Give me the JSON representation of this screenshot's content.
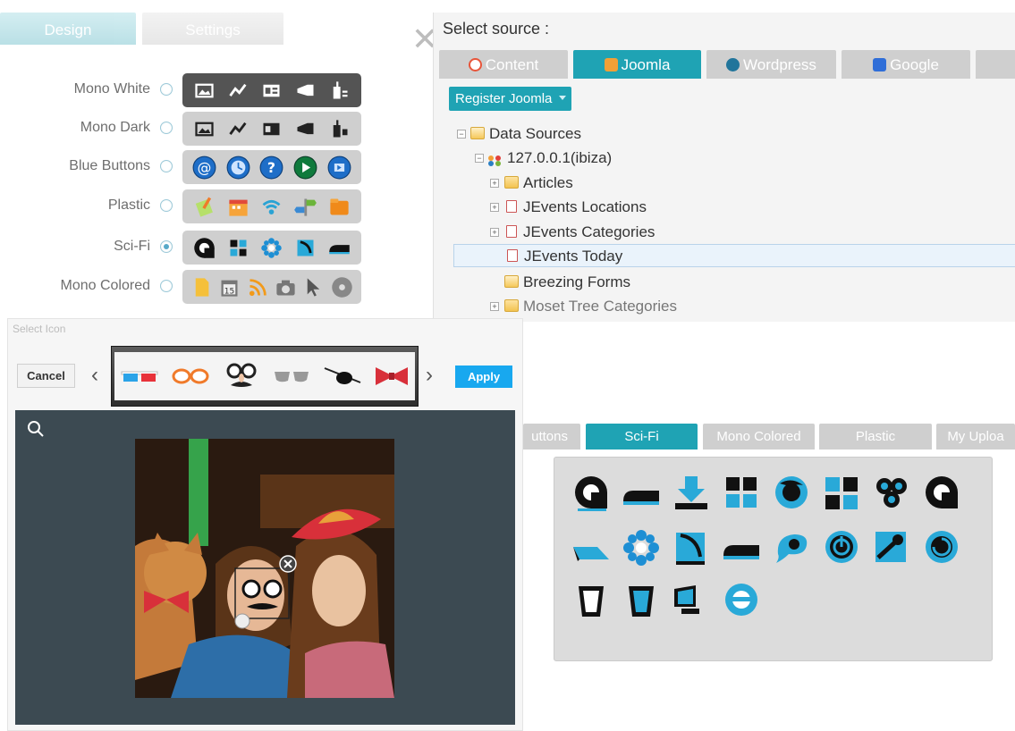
{
  "top_tabs": [
    "Design",
    "Settings"
  ],
  "themes": [
    {
      "label": "Mono White",
      "selected": false,
      "style": "dark",
      "icons": [
        "image-icon",
        "chart-icon",
        "id-card-icon",
        "megaphone-icon",
        "drink-icon"
      ]
    },
    {
      "label": "Mono Dark",
      "selected": false,
      "style": "light",
      "icons": [
        "image-icon",
        "chart-icon",
        "id-card-icon",
        "megaphone-icon",
        "drink-icon"
      ]
    },
    {
      "label": "Blue Buttons",
      "selected": false,
      "style": "light",
      "icons": [
        "at-sign-icon",
        "clock-icon",
        "help-icon",
        "play-icon",
        "video-icon"
      ]
    },
    {
      "label": "Plastic",
      "selected": false,
      "style": "light",
      "icons": [
        "notepad-icon",
        "calendar-icon",
        "wifi-icon",
        "signpost-icon",
        "folder-icon"
      ]
    },
    {
      "label": "Sci-Fi",
      "selected": true,
      "style": "light",
      "icons": [
        "at-sign-icon",
        "windows-icon",
        "flower-icon",
        "feather-icon",
        "button-icon"
      ]
    },
    {
      "label": "Mono Colored",
      "selected": false,
      "style": "light",
      "icons": [
        "document-icon",
        "calendar-icon",
        "rss-icon",
        "camera-icon",
        "cursor-icon",
        "disc-icon"
      ]
    }
  ],
  "source": {
    "title": "Select source :",
    "tabs": [
      {
        "label": "Content",
        "icon": "content-icon",
        "color": "#e8553a",
        "active": false
      },
      {
        "label": "Joomla",
        "icon": "joomla-icon",
        "color": "#f2a036",
        "active": true
      },
      {
        "label": "Wordpress",
        "icon": "wordpress-icon",
        "color": "#21759b",
        "active": false
      },
      {
        "label": "Google",
        "icon": "google-icon",
        "color": "#2f6ed8",
        "active": false
      }
    ],
    "register_button": "Register Joomla",
    "tree": [
      {
        "label": "Data Sources",
        "level": 0,
        "toggle": "−",
        "icon": "folder-open",
        "selected": false
      },
      {
        "label": "127.0.0.1(ibiza)",
        "level": 1,
        "toggle": "−",
        "icon": "joomla",
        "selected": false
      },
      {
        "label": "Articles",
        "level": 2,
        "toggle": "+",
        "icon": "folder",
        "selected": false
      },
      {
        "label": "JEvents Locations",
        "level": 2,
        "toggle": "+",
        "icon": "doc",
        "selected": false
      },
      {
        "label": "JEvents Categories",
        "level": 2,
        "toggle": "+",
        "icon": "doc",
        "selected": false
      },
      {
        "label": "JEvents Today",
        "level": 2,
        "toggle": "",
        "icon": "doc",
        "selected": true
      },
      {
        "label": "Breezing Forms",
        "level": 2,
        "toggle": "",
        "icon": "folder-open",
        "selected": false
      },
      {
        "label": "Moset Tree Categories",
        "level": 2,
        "toggle": "+",
        "icon": "folder",
        "selected": false
      }
    ]
  },
  "select_icon": {
    "title": "Select Icon",
    "cancel": "Cancel",
    "apply": "Apply",
    "stickers": [
      "3d-glasses-icon",
      "orange-glasses-icon",
      "disguise-glasses-icon",
      "sunglasses-icon",
      "eyepatch-icon",
      "bowtie-icon"
    ]
  },
  "bottom": {
    "tabs": [
      {
        "label": "uttons",
        "active": false
      },
      {
        "label": "Sci-Fi",
        "active": true
      },
      {
        "label": "Mono Colored",
        "active": false
      },
      {
        "label": "Plastic",
        "active": false
      },
      {
        "label": "My Uploa",
        "active": false
      }
    ]
  }
}
